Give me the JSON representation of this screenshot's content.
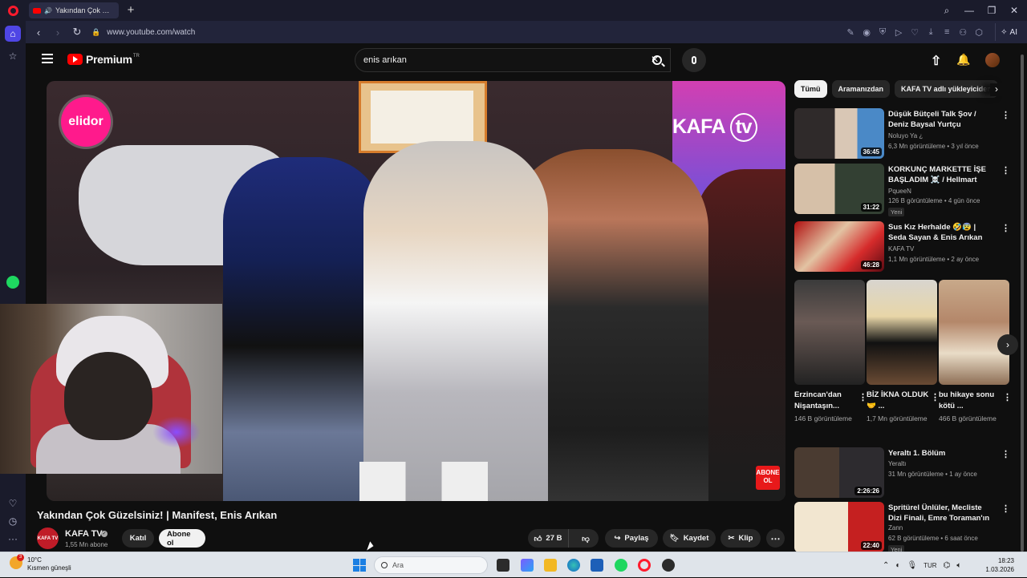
{
  "browser": {
    "tab_title": "Yakından Çok Güzelsiniz!",
    "url": "www.youtube.com/watch",
    "ai_label": "AI"
  },
  "youtube": {
    "logo_text": "Premium",
    "logo_suffix": "TR",
    "search_value": "enis arıkan",
    "search_placeholder": "Ara"
  },
  "video": {
    "overlay_sponsor": "elidor",
    "overlay_channel_logo": "KAFA",
    "overlay_channel_logo_tv": "tv",
    "abone_badge": "ABONE OL",
    "title": "Yakından Çok Güzelsiniz! | Manifest, Enis Arıkan",
    "channel_name": "KAFA TV",
    "channel_avatar_text": "KAFA TV",
    "subscribers": "1,55 Mn abone",
    "join_label": "Katıl",
    "subscribe_label": "Abone ol",
    "likes": "27 B",
    "share_label": "Paylaş",
    "save_label": "Kaydet",
    "clip_label": "Klip"
  },
  "chips": [
    "Tümü",
    "Aramanızdan",
    "KAFA TV adlı yükleyiciden"
  ],
  "recommendations": [
    {
      "title": "Düşük Bütçeli Talk Şov / Deniz Baysal Yurtçu",
      "channel": "Noluyo Ya ¿",
      "meta": "6,3 Mn görüntüleme • 3 yıl önce",
      "duration": "36:45",
      "badge": ""
    },
    {
      "title": "KORKUNÇ MARKETTE İŞE BAŞLADIM ☠️ / Hellmart",
      "channel": "PqueeN",
      "meta": "126 B görüntüleme • 4 gün önce",
      "duration": "31:22",
      "badge": "Yeni"
    },
    {
      "title": "Sus Kız Herhalde 🤣😰 | Seda Sayan & Enis Arıkan",
      "channel": "KAFA TV",
      "meta": "1,1 Mn görüntüleme • 2 ay önce",
      "duration": "46:28",
      "badge": ""
    },
    {
      "title": "Yeraltı 1. Bölüm",
      "channel": "Yeraltı",
      "meta": "31 Mn görüntüleme • 1 ay önce",
      "duration": "2:26:26",
      "badge": ""
    },
    {
      "title": "Spritürel Ünlüler, Mecliste Dizi Finali, Emre Toraman'ın Forması",
      "channel": "Zann",
      "meta": "62 B görüntüleme • 6 saat önce",
      "duration": "22:40",
      "badge": "Yeni"
    }
  ],
  "shorts": [
    {
      "title": "Erzincan'dan Nişantaşın...",
      "views": "146 B görüntüleme"
    },
    {
      "title": "BİZ İKNA OLDUK🤝 ...",
      "views": "1,7 Mn görüntüleme"
    },
    {
      "title": "bu hikaye sonu kötü ...",
      "views": "466 B görüntüleme"
    }
  ],
  "taskbar": {
    "weather_temp": "10°C",
    "weather_desc": "Kısmen güneşli",
    "weather_badge": "3",
    "search_label": "Ara",
    "language": "TUR",
    "time": "18:23",
    "date": "1.03.2026"
  },
  "colors": {
    "youtube_red": "#ff0000",
    "opera_accent": "#4f46e5",
    "background": "#0f0f0f"
  }
}
